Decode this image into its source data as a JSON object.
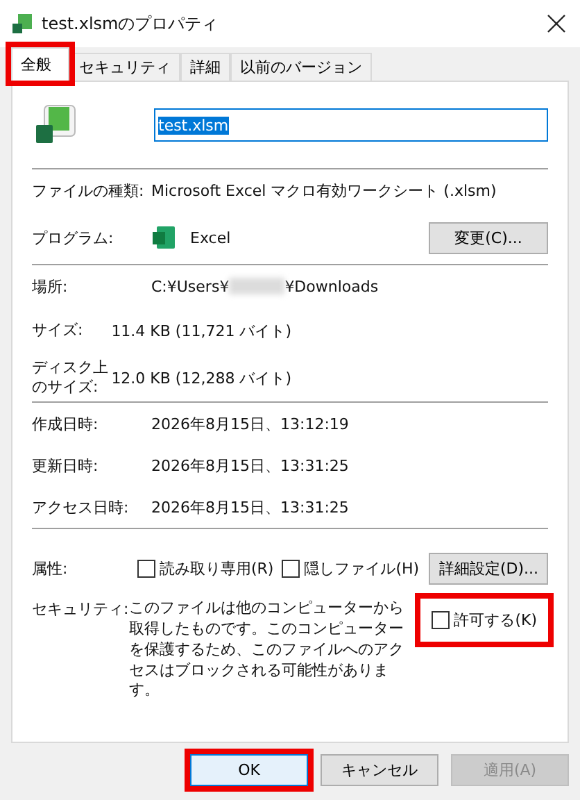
{
  "window": {
    "title": "test.xlsmのプロパティ"
  },
  "tabs": [
    {
      "label": "全般",
      "selected": true,
      "highlighted": true
    },
    {
      "label": "セキュリティ",
      "selected": false,
      "highlighted": false
    },
    {
      "label": "詳細",
      "selected": false,
      "highlighted": false
    },
    {
      "label": "以前のバージョン",
      "selected": false,
      "highlighted": false
    }
  ],
  "file_name": {
    "value": "test.xlsm",
    "selected": true
  },
  "file_type": {
    "label": "ファイルの種類:",
    "value": "Microsoft Excel マクロ有効ワークシート (.xlsm)"
  },
  "program": {
    "label": "プログラム:",
    "value": "Excel",
    "button": "変更(C)..."
  },
  "location": {
    "label": "場所:",
    "value_start": "C:¥Users¥",
    "value_end": "¥Downloads",
    "redacted": true
  },
  "sizes": [
    {
      "label": "サイズ:",
      "value": "11.4 KB (11,721 バイト)"
    },
    {
      "label": "ディスク上のサイズ:",
      "value": "12.0 KB (12,288 バイト)"
    }
  ],
  "dates": [
    {
      "label": "作成日時:",
      "value": "2026年8月15日、13:12:19"
    },
    {
      "label": "更新日時:",
      "value": "2026年8月15日、13:31:25"
    },
    {
      "label": "アクセス日時:",
      "value": "2026年8月15日、13:31:25"
    }
  ],
  "attributes": {
    "label": "属性:",
    "checkboxes": [
      {
        "label": "読み取り専用(R)",
        "checked": false
      },
      {
        "label": "隠しファイル(H)",
        "checked": false
      }
    ],
    "button": "詳細設定(D)..."
  },
  "security": {
    "label": "セキュリティ:",
    "message": "このファイルは他のコンピューターから取得したものです。このコンピューターを保護するため、このファイルへのアクセスはブロックされる可能性があります。",
    "checkbox": {
      "label": "許可する(K)",
      "checked": false,
      "highlighted": true
    }
  },
  "buttons": [
    {
      "label": "OK",
      "kind": "default",
      "disabled": false,
      "highlighted": true
    },
    {
      "label": "キャンセル",
      "kind": "normal",
      "disabled": false,
      "highlighted": false
    },
    {
      "label": "適用(A)",
      "kind": "normal",
      "disabled": true,
      "highlighted": false
    }
  ]
}
